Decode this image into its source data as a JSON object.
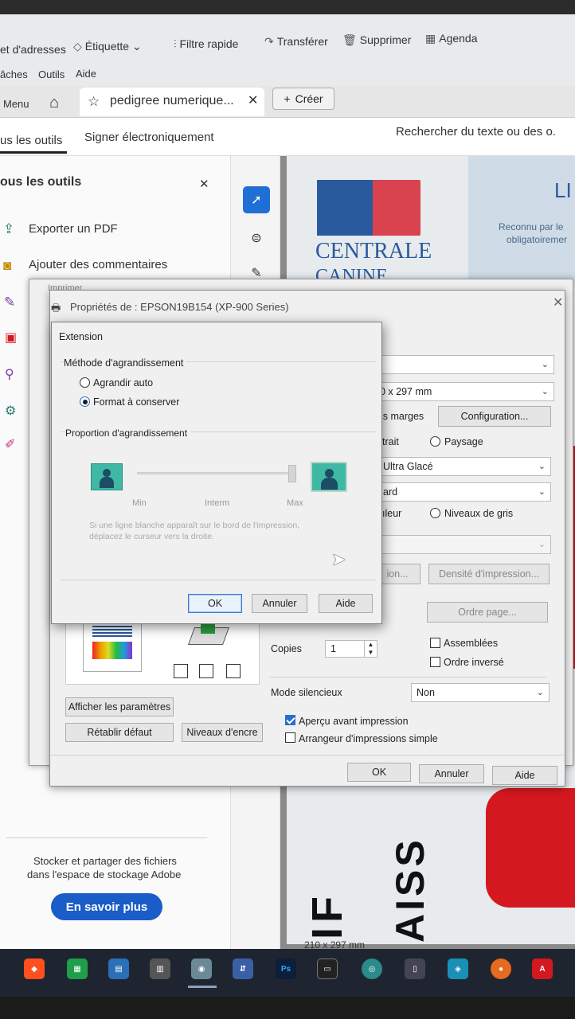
{
  "mail_toolbar": {
    "address_book": "et d'adresses",
    "label": "Étiquette",
    "quick_filter": "Filtre rapide",
    "forward": "Transférer",
    "delete": "Supprimer",
    "agenda": "Agenda",
    "menu_tasks": "âches",
    "menu_tools": "Outils",
    "menu_help": "Aide"
  },
  "acrobat": {
    "menu": "Menu",
    "tab_title": "pedigree numerique...",
    "create": "Créer",
    "all_tools_tab": "us les outils",
    "sign_tab": "Signer électroniquement",
    "search": "Rechercher du texte ou des o.",
    "panel_title": "ous les outils",
    "tools": [
      "Exporter un PDF",
      "Ajouter des commentaires"
    ],
    "storage_text_1": "Stocker et partager des fichiers",
    "storage_text_2": "dans l'espace de stockage Adobe",
    "learn_more": "En savoir plus",
    "page_size": "210 x 297 mm"
  },
  "document": {
    "logo_line1": "CENTRALE",
    "logo_line2": "CANINE",
    "corner_title": "LI",
    "corner_text_1": "Reconnu par le",
    "corner_text_2": "obligatoiremer",
    "vertical_word_1": "IF",
    "vertical_word_2": "AISS",
    "colors": {
      "red": "#d4181f",
      "logo_blue": "#2a5a9e",
      "logo_red": "#d9424f"
    }
  },
  "print_dialog": {
    "title": "Imprimer"
  },
  "properties_dialog": {
    "title": "Propriétés de : EPSON19B154 (XP-900 Series)",
    "paper_size": "0 x 297 mm",
    "borderless": "is marges",
    "configuration": "Configuration...",
    "portrait": "trait",
    "landscape": "Paysage",
    "paper_type": "Ultra Glacé",
    "quality": "ard",
    "color": "ıleur",
    "grayscale": "Niveaux de gris",
    "density_btn_left": "ion...",
    "density": "Densité d'impression...",
    "page_order": "Ordre page...",
    "copies_label": "Copies",
    "copies_value": "1",
    "collate": "Assemblées",
    "reverse": "Ordre inversé",
    "silent_label": "Mode silencieux",
    "silent_value": "Non",
    "preview": "Aperçu avant impression",
    "simple_arranger": "Arrangeur d'impressions simple",
    "show_settings": "Afficher les paramètres",
    "reset": "Rétablir défaut",
    "ink_levels": "Niveaux d'encre",
    "ok": "OK",
    "cancel": "Annuler",
    "help": "Aide"
  },
  "extension_dialog": {
    "title": "Extension",
    "method_group": "Méthode d'agrandissement",
    "auto": "Agrandir auto",
    "keep_format": "Format à conserver",
    "proportion_group": "Proportion d'agrandissement",
    "min": "Min",
    "interm": "Interm",
    "max": "Max",
    "hint_1": "Si une ligne blanche apparaît sur le bord de l'impression,",
    "hint_2": "déplacez le curseur vers la droite.",
    "slider_level": 1.0,
    "ok": "OK",
    "cancel": "Annuler",
    "help": "Aide"
  },
  "taskbar": {
    "apps": [
      "brave",
      "sheets",
      "files",
      "calculator",
      "webcam",
      "network",
      "Ps",
      "terminal",
      "chrome",
      "notepad",
      "remote",
      "firefox",
      "acrobat"
    ]
  }
}
